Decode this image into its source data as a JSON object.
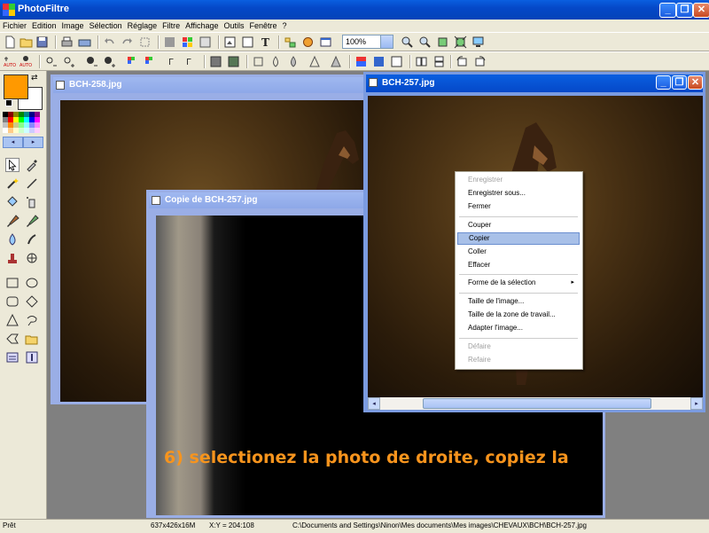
{
  "app": {
    "title": "PhotoFiltre"
  },
  "menu": [
    "Fichier",
    "Edition",
    "Image",
    "Sélection",
    "Réglage",
    "Filtre",
    "Affichage",
    "Outils",
    "Fenêtre",
    "?"
  ],
  "toolbar": {
    "zoom": "100%"
  },
  "palette": {
    "fg_color": "#ff9900",
    "bg_color": "#ffffff"
  },
  "windows": {
    "win1": {
      "title": "BCH-258.jpg"
    },
    "win2": {
      "title": "BCH-257.jpg"
    },
    "win3": {
      "title": "Copie de BCH-257.jpg"
    }
  },
  "context_menu": {
    "items": [
      {
        "label": "Enregistrer",
        "disabled": true
      },
      {
        "label": "Enregistrer sous...",
        "disabled": false
      },
      {
        "label": "Fermer",
        "disabled": false
      },
      {
        "label": "Couper",
        "disabled": false
      },
      {
        "label": "Copier",
        "disabled": false,
        "highlighted": true
      },
      {
        "label": "Coller",
        "disabled": false
      },
      {
        "label": "Effacer",
        "disabled": false
      },
      {
        "label": "Forme de la sélection",
        "disabled": false,
        "submenu": true
      },
      {
        "label": "Taille de l'image...",
        "disabled": false
      },
      {
        "label": "Taille de la zone de travail...",
        "disabled": false
      },
      {
        "label": "Adapter l'image...",
        "disabled": false
      },
      {
        "label": "Défaire",
        "disabled": true
      },
      {
        "label": "Refaire",
        "disabled": true
      }
    ]
  },
  "caption": "6) selectionez la photo de droite, copiez la",
  "status": {
    "state": "Prêt",
    "image_size": "637x426x16M",
    "coords": "X:Y = 204:108",
    "path": "C:\\Documents and Settings\\Ninon\\Mes documents\\Mes images\\CHEVAUX\\BCH\\BCH-257.jpg"
  },
  "colors": {
    "accent": "#0548c8",
    "caption": "#f7941d",
    "highlight": "#a8c0e8"
  }
}
